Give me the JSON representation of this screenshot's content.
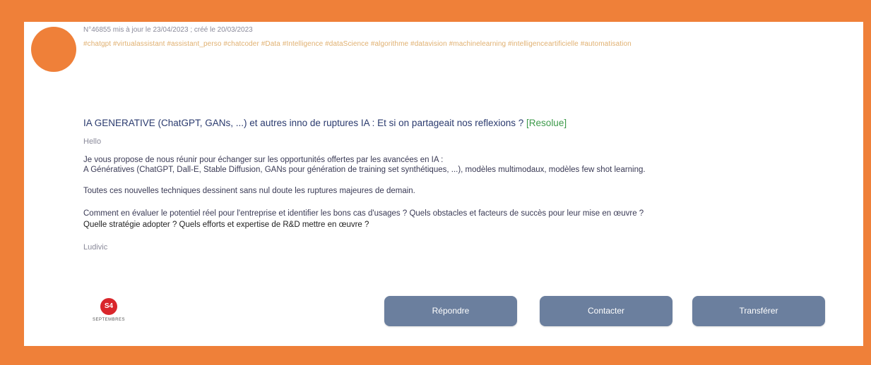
{
  "colors": {
    "frame": "#ef8039",
    "card": "#ffffff",
    "accent_dot": "#ef8039",
    "button": "#6b7f9e",
    "title": "#2a3a6e",
    "resolved": "#3d9a4a",
    "tags": "#e0b070"
  },
  "post": {
    "meta": "N°46855 mis à jour le 23/04/2023 ; créé le 20/03/2023",
    "tags": "#chatgpt #virtualassistant #assistant_perso #chatcoder #Data #Intelligence #dataScience #algorithme #datavision #machinelearning #intelligenceartificielle #automatisation",
    "title": "IA GENERATIVE (ChatGPT, GANs, ...) et autres inno de ruptures IA : Et si on partageait nos reflexions ?",
    "status": "[Resolue]",
    "greeting": "Hello",
    "paragraphs": [
      "Je vous propose de nous réunir pour échanger sur les opportunités offertes par les avancées en IA :",
      "A Génératives (ChatGPT, Dall-E, Stable Diffusion, GANs pour génération de training set synthétiques, ...), modèles multimodaux, modèles few shot learning.",
      "Toutes ces nouvelles techniques dessinent sans nul doute les ruptures majeures de demain.",
      "Comment en évaluer le potentiel réel pour l'entreprise et identifier les bons cas d'usages ? Quels obstacles et facteurs de succès pour leur mise en œuvre ?",
      "Quelle stratégie adopter ? Quels efforts et expertise de R&D mettre en œuvre ?"
    ],
    "signature": "Ludivic"
  },
  "brand": {
    "mark": "S4",
    "name": "SEPTEMBRES"
  },
  "actions": {
    "reply": "Répondre",
    "contact": "Contacter",
    "forward": "Transférer"
  }
}
